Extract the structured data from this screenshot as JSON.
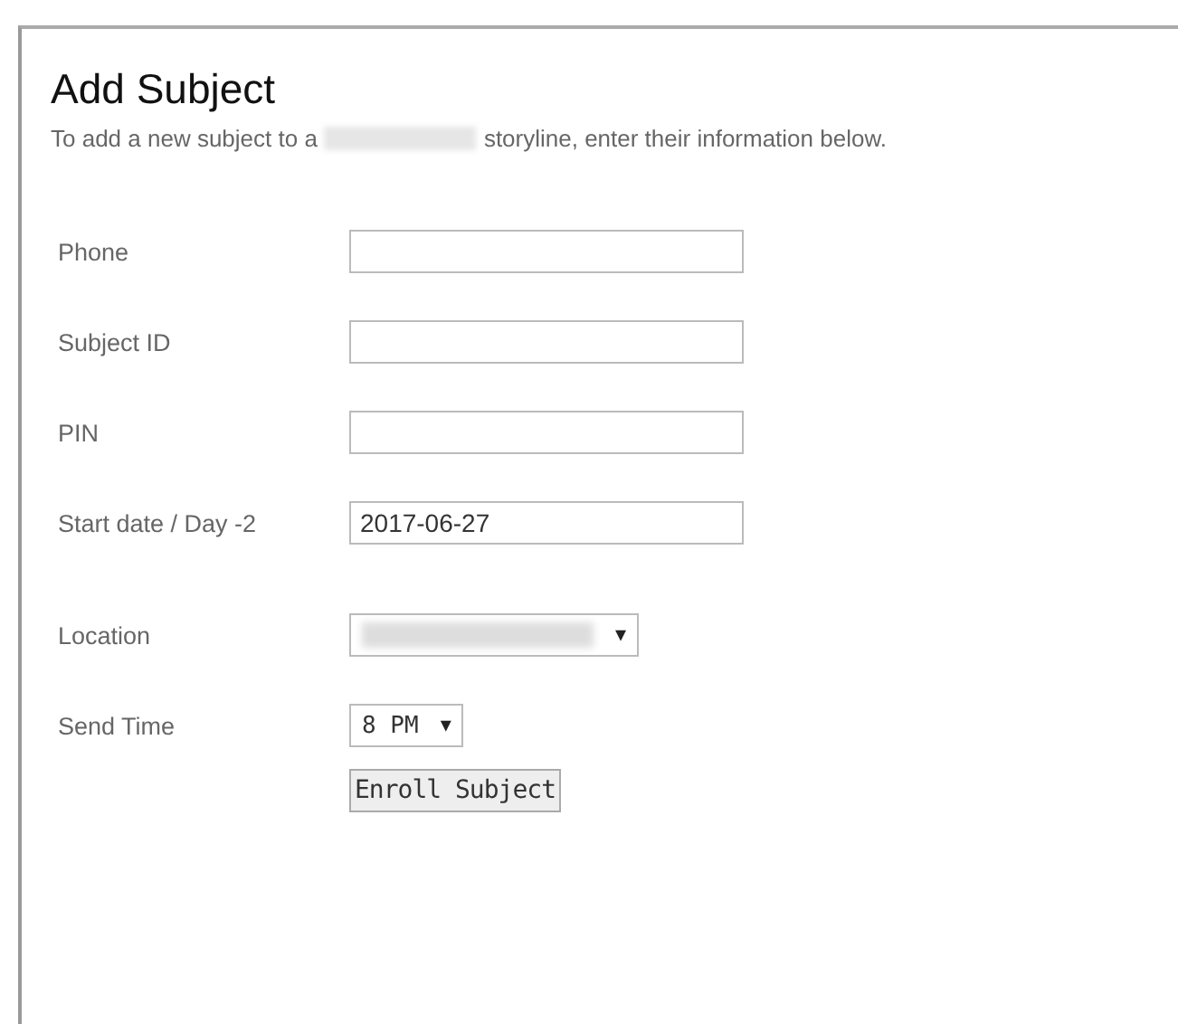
{
  "title": "Add Subject",
  "description": {
    "before": "To add a new subject to a",
    "redacted": true,
    "after": "storyline, enter their information below."
  },
  "fields": [
    {
      "label": "Phone",
      "kind": "text"
    },
    {
      "label": "Subject ID",
      "kind": "text"
    },
    {
      "label": "PIN",
      "kind": "text"
    },
    {
      "label": "Start date / Day -2",
      "kind": "text",
      "value": "2017-06-27"
    }
  ],
  "schedule_fields": [
    {
      "label": "Location",
      "kind": "select",
      "redacted": true
    },
    {
      "label": "Send Time",
      "kind": "select",
      "value": "8 PM",
      "arrow": "▼"
    }
  ],
  "location_arrow": "▼",
  "button": "Enroll Subject"
}
